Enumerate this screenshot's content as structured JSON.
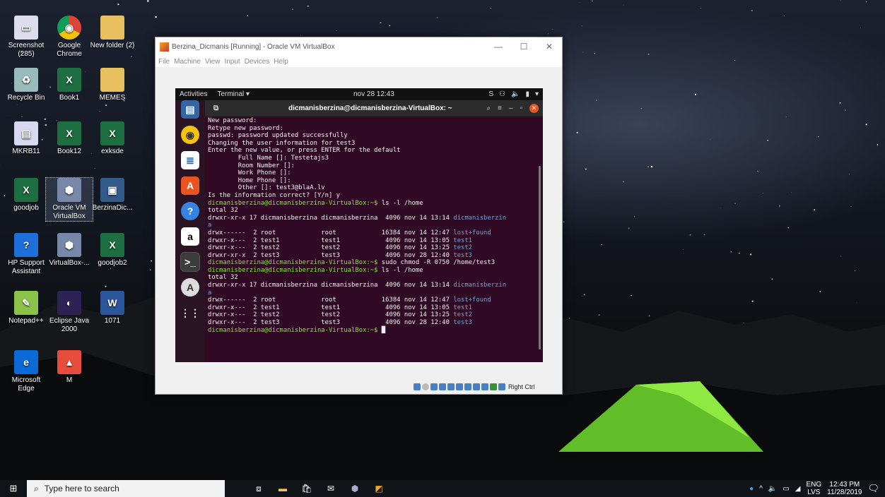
{
  "desktop": {
    "icons": [
      {
        "label": "Screenshot (285)",
        "icon": "screenshot-file-icon"
      },
      {
        "label": "Google Chrome",
        "icon": "chrome-icon"
      },
      {
        "label": "New folder (2)",
        "icon": "folder-icon"
      },
      {
        "label": "Recycle Bin",
        "icon": "recycle-bin-icon"
      },
      {
        "label": "Book1",
        "icon": "excel-icon"
      },
      {
        "label": "MEMES",
        "icon": "folder-icon"
      },
      {
        "label": "MKRB11",
        "icon": "file-icon"
      },
      {
        "label": "Book12",
        "icon": "excel-icon"
      },
      {
        "label": "exksde",
        "icon": "excel-icon"
      },
      {
        "label": "goodjob",
        "icon": "excel-icon"
      },
      {
        "label": "Oracle VM VirtualBox",
        "icon": "virtualbox-icon"
      },
      {
        "label": "BerzinaDic...",
        "icon": "vm-shortcut-icon"
      },
      {
        "label": "HP Support Assistant",
        "icon": "help-icon"
      },
      {
        "label": "VirtualBox-...",
        "icon": "virtualbox-icon"
      },
      {
        "label": "goodjob2",
        "icon": "excel-icon"
      },
      {
        "label": "Notepad++",
        "icon": "notepad-icon"
      },
      {
        "label": "Eclipse Java 2000",
        "icon": "eclipse-icon"
      },
      {
        "label": "1071",
        "icon": "word-icon"
      },
      {
        "label": "Microsoft Edge",
        "icon": "edge-icon"
      },
      {
        "label": "M",
        "icon": "pdf-icon"
      }
    ]
  },
  "vbox": {
    "title": "Berzina_Dicmanis [Running] - Oracle VM VirtualBox",
    "menu": [
      "File",
      "Machine",
      "View",
      "Input",
      "Devices",
      "Help"
    ],
    "host_key": "Right Ctrl"
  },
  "guest": {
    "activities": "Activities",
    "app_menu": "Terminal ▾",
    "clock": "nov 28  12:43",
    "terminal_title": "dicmanisberzina@dicmanisberzina-VirtualBox: ~"
  },
  "terminal_lines": [
    {
      "t": "New password:",
      "c": ""
    },
    {
      "t": "Retype new password:",
      "c": ""
    },
    {
      "t": "passwd: password updated successfully",
      "c": ""
    },
    {
      "t": "Changing the user information for test3",
      "c": ""
    },
    {
      "t": "Enter the new value, or press ENTER for the default",
      "c": ""
    },
    {
      "t": "        Full Name []: Testetajs3",
      "c": ""
    },
    {
      "t": "        Room Number []:",
      "c": ""
    },
    {
      "t": "        Work Phone []:",
      "c": ""
    },
    {
      "t": "        Home Phone []:",
      "c": ""
    },
    {
      "t": "        Other []: test3@blaA.lv",
      "c": ""
    },
    {
      "t": "Is the information correct? [Y/n] y",
      "c": ""
    },
    {
      "t": "dicmanisberzina@dicmanisberzina-VirtualBox:~$ ls -l /home",
      "c": "p"
    },
    {
      "t": "total 32",
      "c": ""
    },
    {
      "t": "drwxr-xr-x 17 dicmanisberzina dicmanisberzina  4096 nov 14 13:14 dicmanisberzin",
      "c": "b"
    },
    {
      "t": "a",
      "c": "b"
    },
    {
      "t": "drwx------  2 root            root            16384 nov 14 12:47 lost+found",
      "c": "b"
    },
    {
      "t": "drwxr-x---  2 test1           test1            4096 nov 14 13:05 test1",
      "c": "b"
    },
    {
      "t": "drwxr-x---  2 test2           test2            4096 nov 14 13:25 test2",
      "c": "b"
    },
    {
      "t": "drwxr-xr-x  2 test3           test3            4096 nov 28 12:40 test3",
      "c": "b"
    },
    {
      "t": "dicmanisberzina@dicmanisberzina-VirtualBox:~$ sudo chmod -R 0750 /home/test3",
      "c": "p"
    },
    {
      "t": "dicmanisberzina@dicmanisberzina-VirtualBox:~$ ls -l /home",
      "c": "p"
    },
    {
      "t": "total 32",
      "c": ""
    },
    {
      "t": "drwxr-xr-x 17 dicmanisberzina dicmanisberzina  4096 nov 14 13:14 dicmanisberzin",
      "c": "b"
    },
    {
      "t": "a",
      "c": "b"
    },
    {
      "t": "drwx------  2 root            root            16384 nov 14 12:47 lost+found",
      "c": "b"
    },
    {
      "t": "drwxr-x---  2 test1           test1            4096 nov 14 13:05 test1",
      "c": "b"
    },
    {
      "t": "drwxr-x---  2 test2           test2            4096 nov 14 13:25 test2",
      "c": "b"
    },
    {
      "t": "drwxr-x---  2 test3           test3            4096 nov 28 12:40 test3",
      "c": "b"
    },
    {
      "t": "dicmanisberzina@dicmanisberzina-VirtualBox:~$ ",
      "c": "p"
    }
  ],
  "taskbar": {
    "search_placeholder": "Type here to search",
    "lang": "ENG",
    "lang2": "LVS",
    "time": "12:43 PM",
    "date": "11/28/2019"
  }
}
